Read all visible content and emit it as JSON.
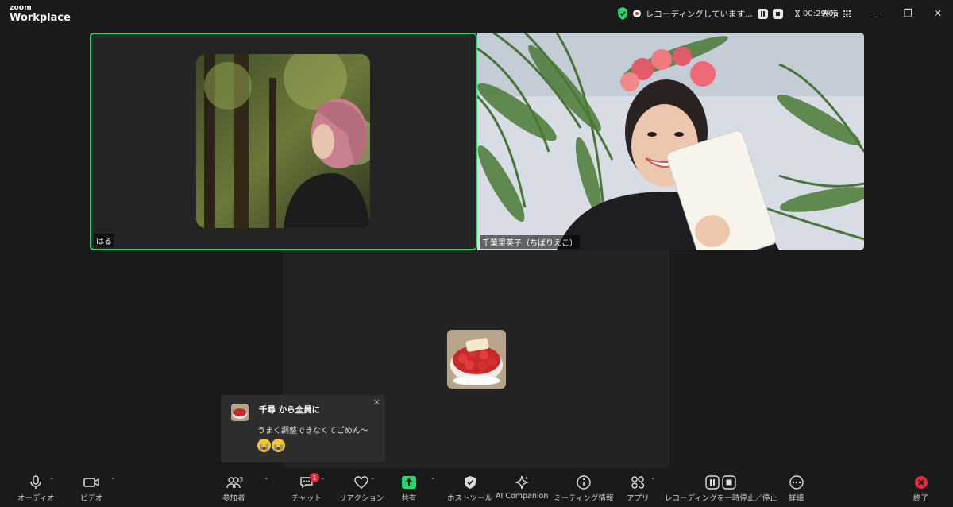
{
  "app": {
    "brand_top": "zoom",
    "brand_bottom": "Workplace"
  },
  "recording": {
    "status": "レコーディングしています...",
    "timer": "00:29:05"
  },
  "view": {
    "label": "表示"
  },
  "participants": [
    {
      "name": "はる"
    },
    {
      "name": "千葉里英子（ちばりえこ）"
    },
    {
      "name": ""
    }
  ],
  "chat": {
    "from": "千尋 から全員に",
    "message": "うまく調整できなくてごめん〜"
  },
  "toolbar": {
    "audio": "オーディオ",
    "video": "ビデオ",
    "participants": "参加者",
    "participant_count": "3",
    "chat": "チャット",
    "chat_badge": "1",
    "reactions": "リアクション",
    "share": "共有",
    "host_tools": "ホストツール",
    "ai_companion": "AI Companion",
    "meeting_info": "ミーティング情報",
    "apps": "アプリ",
    "recording": "レコーディングを一時停止／停止",
    "more": "詳細",
    "end": "終了"
  },
  "colors": {
    "active_speaker": "#23d96e",
    "share": "#23d96e",
    "end": "#e02b3b",
    "badge": "#e02b3b"
  }
}
